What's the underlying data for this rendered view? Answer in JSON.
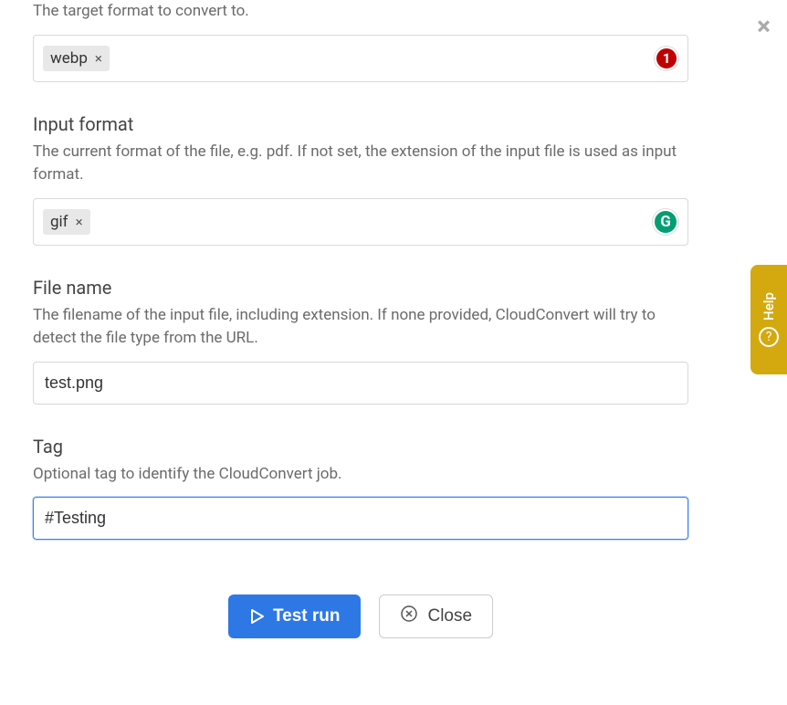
{
  "fields": {
    "output_format": {
      "description": "The target format to convert to.",
      "tag_value": "webp",
      "badge_count": "1"
    },
    "input_format": {
      "label": "Input format",
      "description": "The current format of the file, e.g. pdf. If not set, the extension of the input file is used as input format.",
      "tag_value": "gif",
      "badge_letter": "G"
    },
    "file_name": {
      "label": "File name",
      "description": "The filename of the input file, including extension. If none provided, CloudConvert will try to detect the file type from the URL.",
      "value": "test.png"
    },
    "tag": {
      "label": "Tag",
      "description": "Optional tag to identify the CloudConvert job.",
      "value": "#Testing"
    }
  },
  "buttons": {
    "test_run": "Test run",
    "close": "Close"
  },
  "help": {
    "label": "Help",
    "icon_char": "?"
  }
}
